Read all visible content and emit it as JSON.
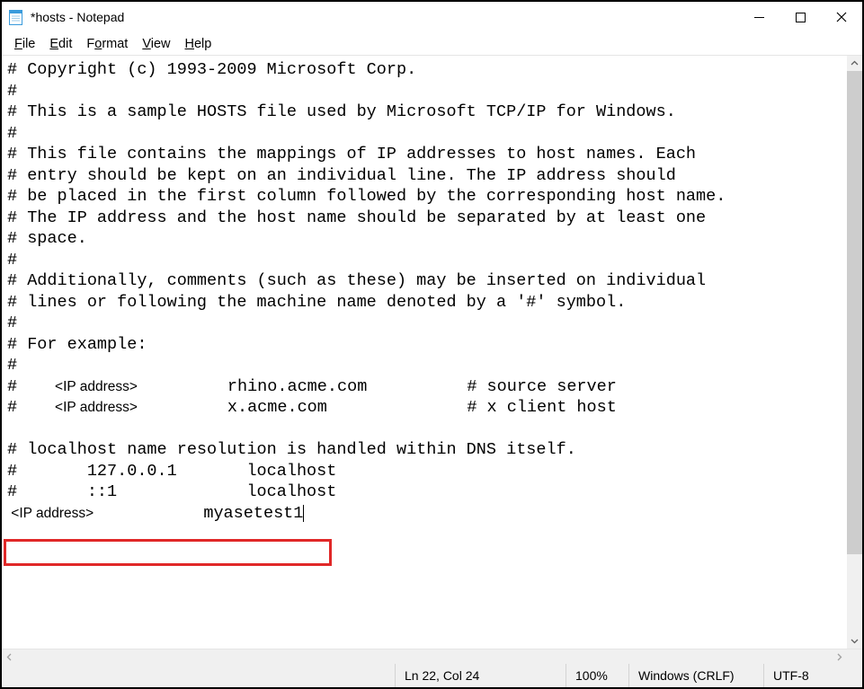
{
  "window": {
    "title": "*hosts - Notepad"
  },
  "menu": {
    "file": "File",
    "edit": "Edit",
    "format": "Format",
    "view": "View",
    "help": "Help"
  },
  "editor": {
    "lines": {
      "l1": "# Copyright (c) 1993-2009 Microsoft Corp.",
      "l2": "#",
      "l3": "# This is a sample HOSTS file used by Microsoft TCP/IP for Windows.",
      "l4": "#",
      "l5": "# This file contains the mappings of IP addresses to host names. Each",
      "l6": "# entry should be kept on an individual line. The IP address should",
      "l7": "# be placed in the first column followed by the corresponding host name.",
      "l8": "# The IP address and the host name should be separated by at least one",
      "l9": "# space.",
      "l10": "#",
      "l11": "# Additionally, comments (such as these) may be inserted on individual",
      "l12": "# lines or following the machine name denoted by a '#' symbol.",
      "l13": "#",
      "l14": "# For example:",
      "l15": "#",
      "l16a": "#   ",
      "l16b": "  <IP address>",
      "l16c": "         rhino.acme.com          # source server",
      "l17a": "#   ",
      "l17b": "  <IP address>",
      "l17c": "         x.acme.com              # x client host",
      "l18": "",
      "l19": "# localhost name resolution is handled within DNS itself.",
      "l20": "#       127.0.0.1       localhost",
      "l21": "#       ::1             localhost",
      "l22a": " <IP address>",
      "l22b": "           myasetest1"
    }
  },
  "status": {
    "position": "Ln 22, Col 24",
    "zoom": "100%",
    "eol": "Windows (CRLF)",
    "encoding": "UTF-8"
  }
}
